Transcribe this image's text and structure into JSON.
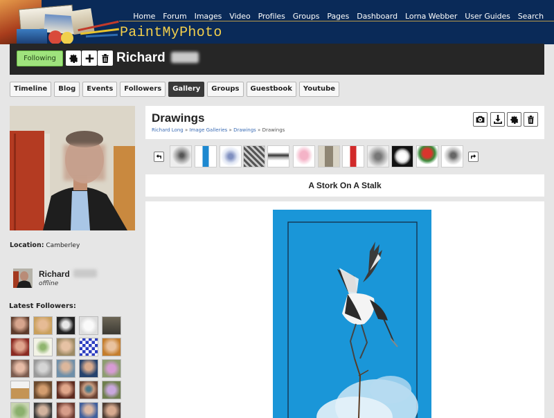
{
  "site": {
    "logo_text": "PaintMyPhoto"
  },
  "nav": [
    "Home",
    "Forum",
    "Images",
    "Video",
    "Profiles",
    "Groups",
    "Pages",
    "Dashboard",
    "Lorna Webber",
    "User Guides",
    "Search"
  ],
  "profile": {
    "follow_label": "Following",
    "first_name": "Richard",
    "location_label": "Location:",
    "location_value": "Camberley",
    "status": "offline"
  },
  "tabs": [
    "Timeline",
    "Blog",
    "Events",
    "Followers",
    "Gallery",
    "Groups",
    "Guestbook",
    "Youtube"
  ],
  "active_tab": "Gallery",
  "sidebar": {
    "followers_title": "Latest Followers:"
  },
  "gallery": {
    "title": "Drawings",
    "breadcrumb": [
      "Richard Long",
      "Image Galleries",
      "Drawings",
      "Drawings"
    ],
    "image_title": "A Stork On A Stalk"
  },
  "icons": {
    "profile_bar": [
      "gear-icon",
      "plus-icon",
      "trash-icon"
    ],
    "gallery_tools": [
      "camera-icon",
      "download-icon",
      "gear-icon",
      "trash-icon"
    ],
    "strip_prev": "arrow-left-icon",
    "strip_next": "arrow-right-icon"
  },
  "colors": {
    "header": "#0a2a58",
    "logo": "#f2cf4c",
    "follow": "#9fe37d",
    "profile_bar": "#262626",
    "painting_bg": "#1a96d8"
  }
}
